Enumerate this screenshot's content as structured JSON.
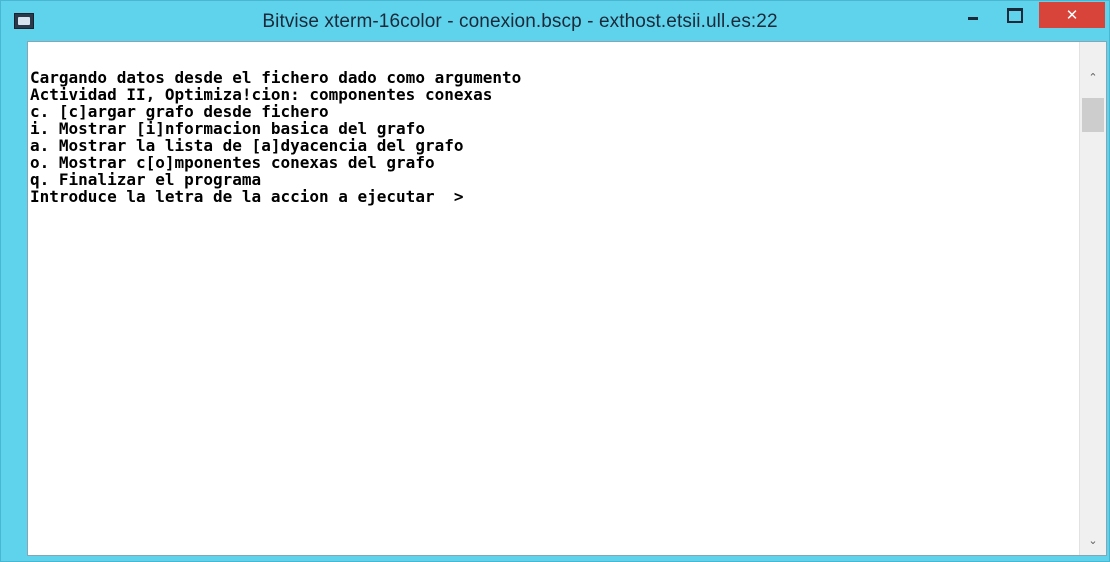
{
  "window": {
    "title": "Bitvise xterm-16color - conexion.bscp - exthost.etsii.ull.es:22",
    "controls": {
      "minimize_icon": "minimize-icon",
      "maximize_icon": "maximize-icon",
      "close_glyph": "✕"
    }
  },
  "terminal": {
    "lines": [
      "Cargando datos desde el fichero dado como argumento",
      "Actividad II, Optimiza!cion: componentes conexas",
      "c. [c]argar grafo desde fichero",
      "i. Mostrar [i]nformacion basica del grafo",
      "a. Mostrar la lista de [a]dyacencia del grafo",
      "o. Mostrar c[o]mponentes conexas del grafo",
      "q. Finalizar el programa",
      "Introduce la letra de la accion a ejecutar  >"
    ]
  },
  "scrollbar": {
    "up_glyph": "⌃",
    "down_glyph": "⌄"
  },
  "colors": {
    "titlebar": "#5fd3ec",
    "close_button": "#d9443a",
    "terminal_background": "#ffffff",
    "terminal_text": "#000000"
  }
}
